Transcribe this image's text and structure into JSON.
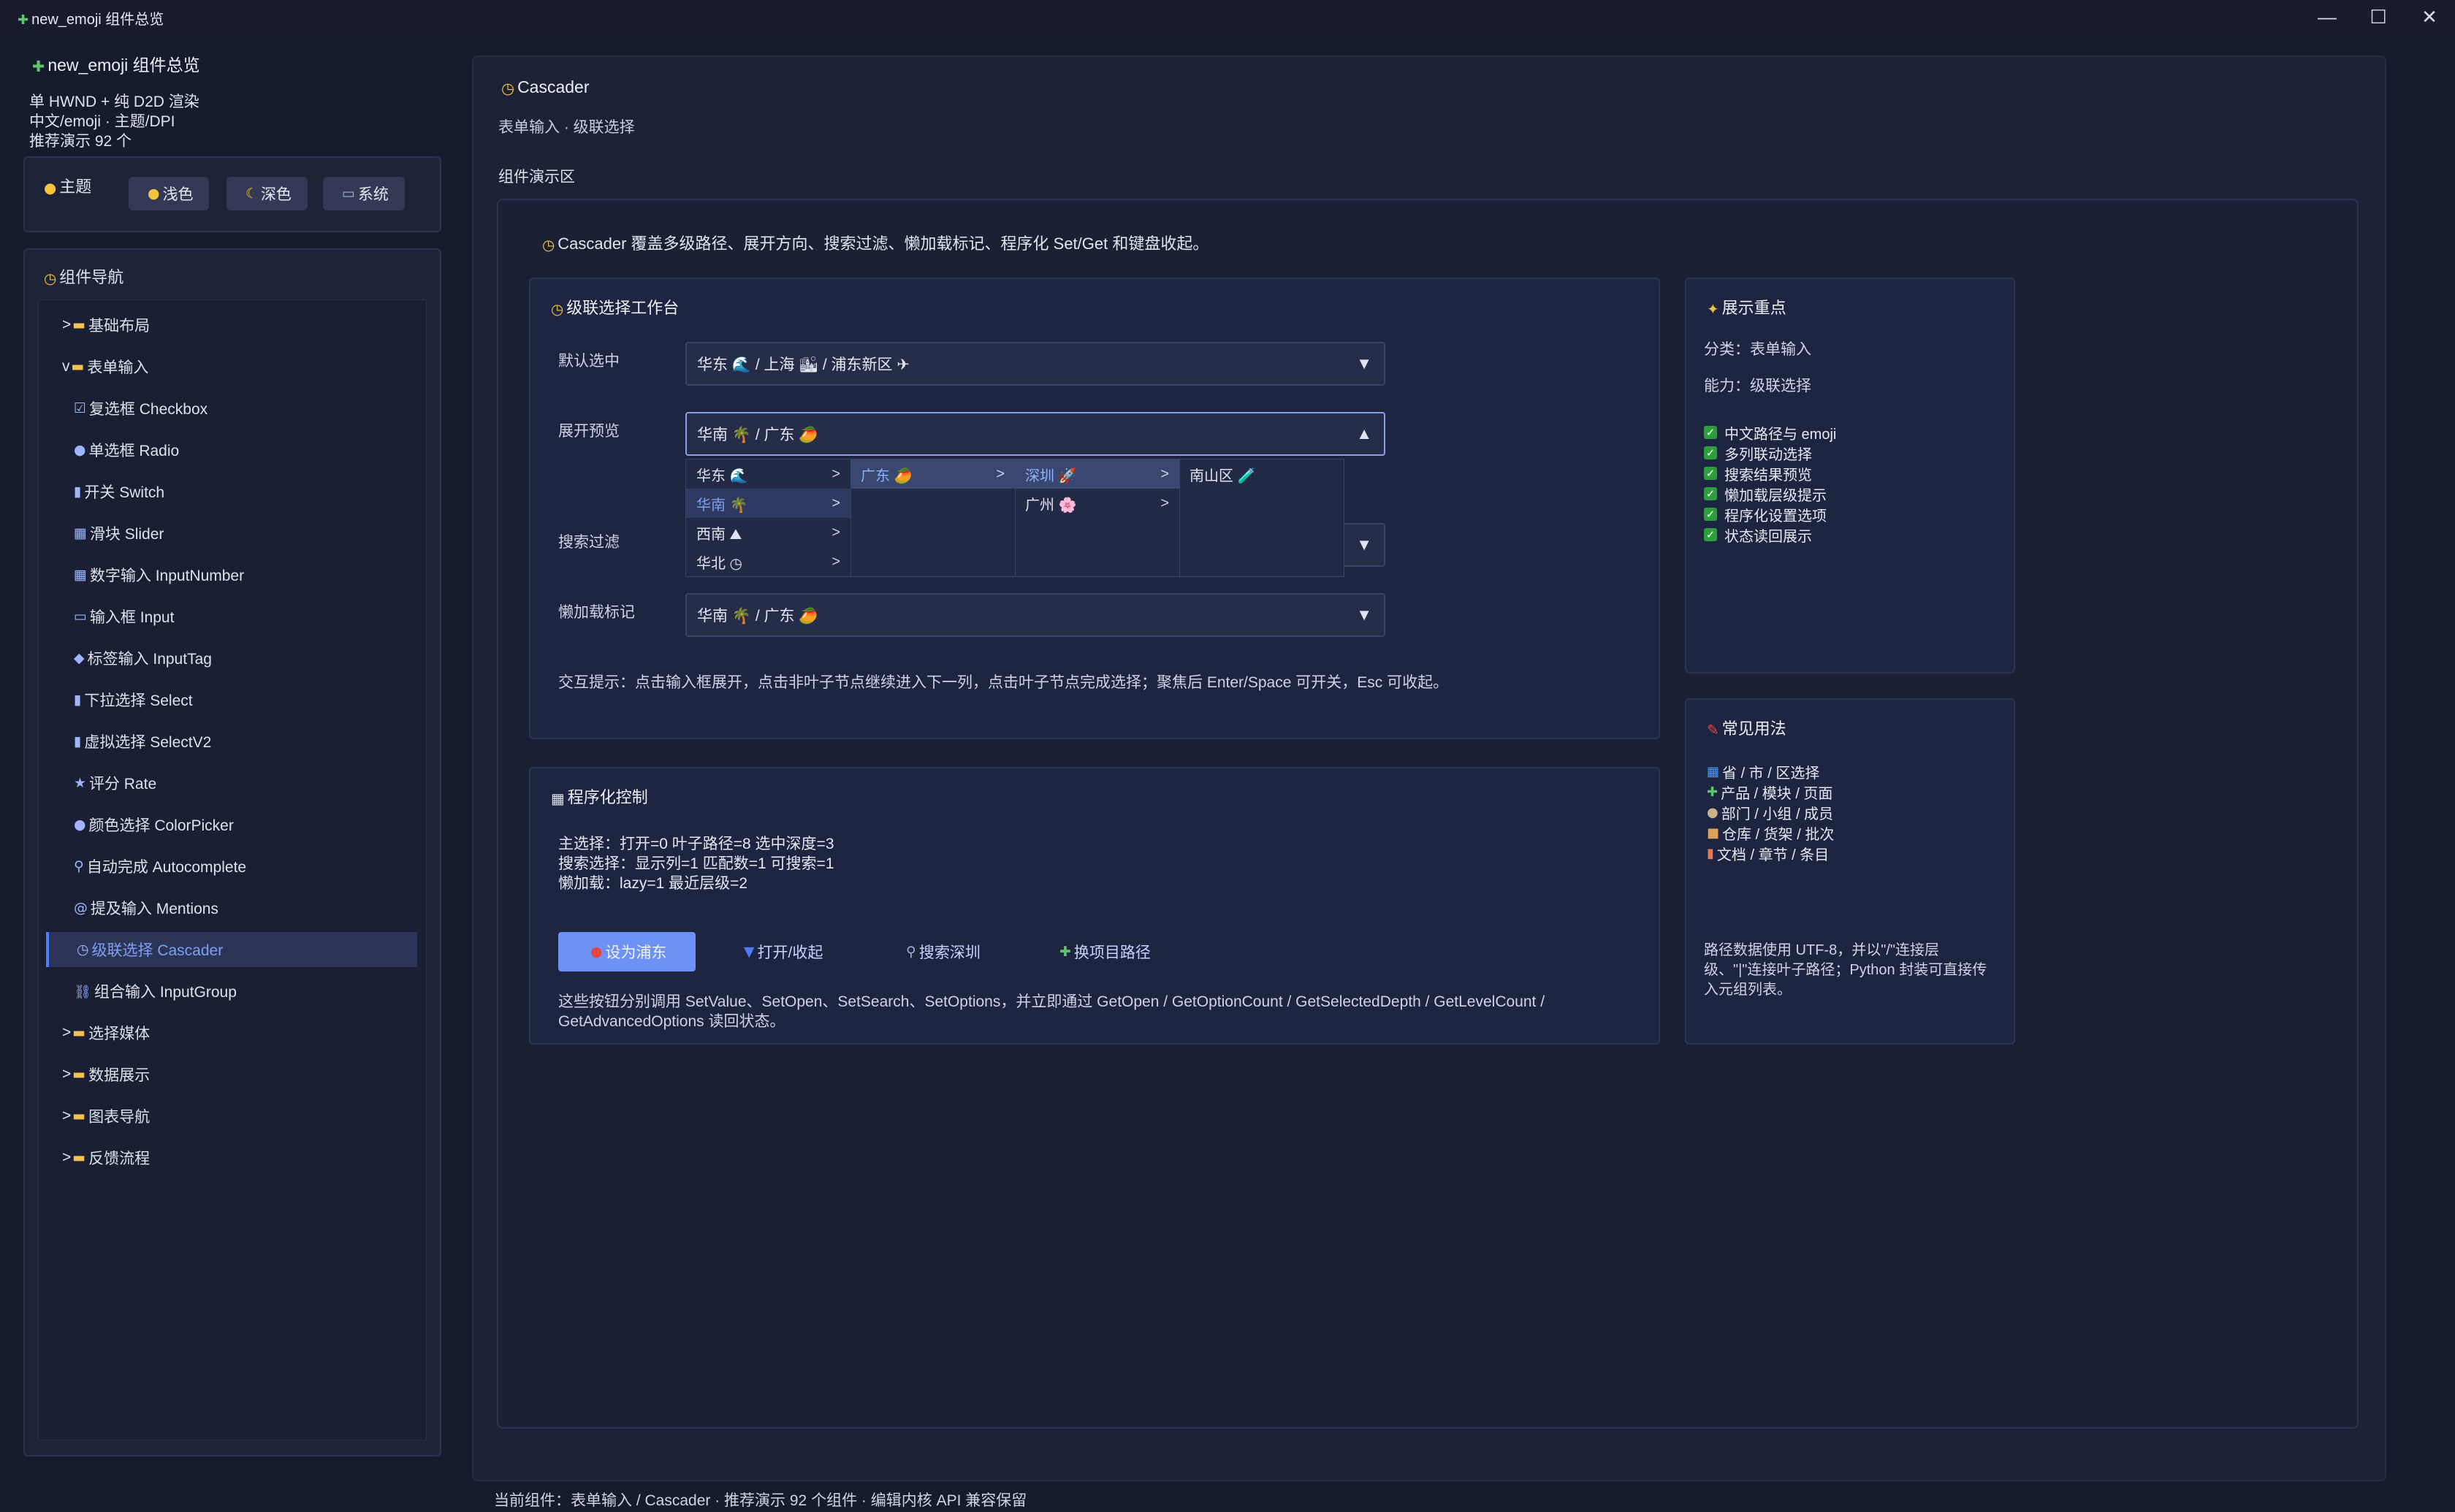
{
  "window": {
    "title": "new_emoji 组件总览",
    "icon": "puzzle-icon",
    "minimize": "—",
    "maximize": "☐",
    "close": "✕"
  },
  "sidebar": {
    "app_title": "new_emoji 组件总览",
    "lines": [
      "单 HWND + 纯 D2D 渲染",
      "中文/emoji · 主题/DPI",
      "推荐演示 92 个"
    ],
    "theme_label": "主题",
    "theme_buttons": [
      "浅色",
      "深色",
      "系统"
    ],
    "nav_title": "组件导航",
    "nav": [
      {
        "label": "基础布局",
        "prefix": ">",
        "icon": "📁"
      },
      {
        "label": "表单输入",
        "prefix": "v",
        "icon": "📁"
      },
      {
        "label": "复选框 Checkbox",
        "icon": "☑"
      },
      {
        "label": "单选框 Radio",
        "icon": "●"
      },
      {
        "label": "开关 Switch",
        "icon": "▮"
      },
      {
        "label": "滑块 Slider",
        "icon": "▦"
      },
      {
        "label": "数字输入 InputNumber",
        "icon": "▦"
      },
      {
        "label": "输入框 Input",
        "icon": "▭"
      },
      {
        "label": "标签输入 InputTag",
        "icon": "◆"
      },
      {
        "label": "下拉选择 Select",
        "icon": "▮"
      },
      {
        "label": "虚拟选择 SelectV2",
        "icon": "▮"
      },
      {
        "label": "评分 Rate",
        "icon": "★"
      },
      {
        "label": "颜色选择 ColorPicker",
        "icon": "●"
      },
      {
        "label": "自动完成 Autocomplete",
        "icon": "⚲"
      },
      {
        "label": "提及输入 Mentions",
        "icon": "@"
      },
      {
        "label": "级联选择 Cascader",
        "icon": "◷"
      },
      {
        "label": "组合输入 InputGroup",
        "icon": "⛓"
      },
      {
        "label": "选择媒体",
        "prefix": ">",
        "icon": "📁"
      },
      {
        "label": "数据展示",
        "prefix": ">",
        "icon": "📁"
      },
      {
        "label": "图表导航",
        "prefix": ">",
        "icon": "📁"
      },
      {
        "label": "反馈流程",
        "prefix": ">",
        "icon": "📁"
      }
    ]
  },
  "main": {
    "title": "Cascader",
    "subtitle": "表单输入 · 级联选择",
    "demo_label": "组件演示区",
    "description": "Cascader 覆盖多级路径、展开方向、搜索过滤、懒加载标记、程序化 Set/Get 和键盘收起。",
    "workbench": {
      "title": "级联选择工作台",
      "rows": [
        {
          "label": "默认选中",
          "value": "华东 🌊 / 上海 🏙 / 浦东新区 ✈"
        },
        {
          "label": "展开预览",
          "value": "华南 🌴 / 广东 🥭"
        },
        {
          "label": "搜索过滤",
          "value": ""
        },
        {
          "label": "懒加载标记",
          "value": "华南 🌴 / 广东 🥭"
        }
      ],
      "dropdown": {
        "col1": [
          "华东 🌊",
          "华南 🌴",
          "西南 ⛰",
          "华北 ◷"
        ],
        "col2": [
          "广东 🥭"
        ],
        "col3": [
          "深圳 🚀",
          "广州 🌸"
        ],
        "col4": [
          "南山区 🧪"
        ]
      },
      "hint": "交互提示：点击输入框展开，点击非叶子节点继续进入下一列，点击叶子节点完成选择；聚焦后 Enter/Space 可开关，Esc 可收起。"
    },
    "program": {
      "title": "程序化控制",
      "lines": [
        "主选择：打开=0 叶子路径=8 选中深度=3",
        "搜索选择：显示列=1 匹配数=1 可搜索=1",
        "懒加载：lazy=1 最近层级=2"
      ],
      "buttons": [
        "设为浦东",
        "打开/收起",
        "搜索深圳",
        "换项目路径"
      ],
      "note": "这些按钮分别调用 SetValue、SetOpen、SetSearch、SetOptions，并立即通过 GetOpen / GetOptionCount / GetSelectedDepth / GetLevelCount / GetAdvancedOptions 读回状态。"
    },
    "focus": {
      "title": "展示重点",
      "category": "分类：表单输入",
      "ability": "能力：级联选择",
      "checks": [
        "中文路径与 emoji",
        "多列联动选择",
        "搜索结果预览",
        "懒加载层级提示",
        "程序化设置选项",
        "状态读回展示"
      ]
    },
    "usage": {
      "title": "常见用法",
      "items": [
        "省 / 市 / 区选择",
        "产品 / 模块 / 页面",
        "部门 / 小组 / 成员",
        "仓库 / 货架 / 批次",
        "文档 / 章节 / 条目"
      ],
      "note": "路径数据使用 UTF-8，并以\"/\"连接层级、\"|\"连接叶子路径；Python 封装可直接传入元组列表。"
    }
  },
  "status": "当前组件：表单输入 / Cascader · 推荐演示 92 个组件 · 编辑内核 API 兼容保留"
}
